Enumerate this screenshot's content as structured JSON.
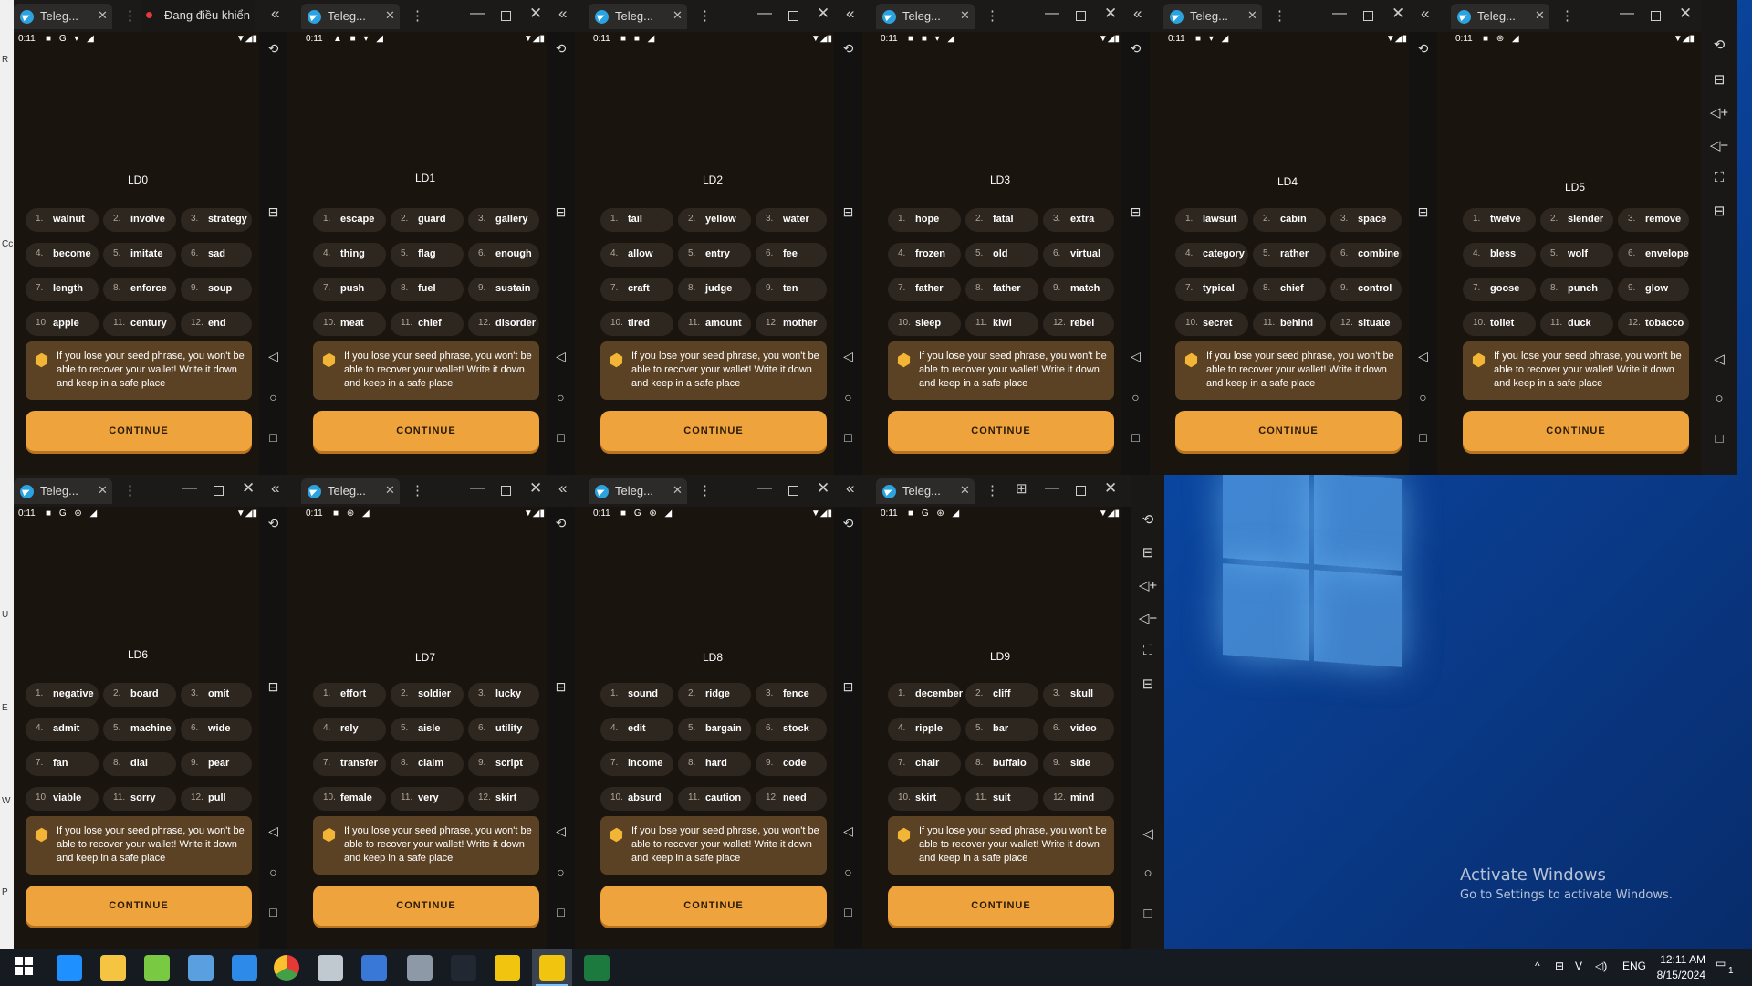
{
  "desktop": {
    "activate_title": "Activate Windows",
    "activate_sub": "Go to Settings to activate Windows."
  },
  "controller_label": "Đang điều khiển",
  "left_strip_letters": [
    "R",
    "Cc",
    "U",
    "E",
    "W",
    "P"
  ],
  "panels": [
    {
      "tab_title": "Teleg...",
      "status_time": "0:11",
      "status_icons": "■ G ▾ ◢",
      "label": "LD0",
      "words": [
        "walnut",
        "involve",
        "strategy",
        "become",
        "imitate",
        "sad",
        "length",
        "enforce",
        "soup",
        "apple",
        "century",
        "end"
      ],
      "warning": "If you lose your seed phrase, you won't be able to recover your wallet! Write it down and keep in a safe place",
      "button": "CONTINUE"
    },
    {
      "tab_title": "Teleg...",
      "status_time": "0:11",
      "status_icons": "▲ ■ ▾ ◢",
      "label": "LD1",
      "words": [
        "escape",
        "guard",
        "gallery",
        "thing",
        "flag",
        "enough",
        "push",
        "fuel",
        "sustain",
        "meat",
        "chief",
        "disorder"
      ],
      "warning": "If you lose your seed phrase, you won't be able to recover your wallet! Write it down and keep in a safe place",
      "button": "CONTINUE"
    },
    {
      "tab_title": "Teleg...",
      "status_time": "0:11",
      "status_icons": "■ ■ ◢",
      "label": "LD2",
      "words": [
        "tail",
        "yellow",
        "water",
        "allow",
        "entry",
        "fee",
        "craft",
        "judge",
        "ten",
        "tired",
        "amount",
        "mother"
      ],
      "warning": "If you lose your seed phrase, you won't be able to recover your wallet! Write it down and keep in a safe place",
      "button": "CONTINUE"
    },
    {
      "tab_title": "Teleg...",
      "status_time": "0:11",
      "status_icons": "■ ■ ▾ ◢",
      "label": "LD3",
      "words": [
        "hope",
        "fatal",
        "extra",
        "frozen",
        "old",
        "virtual",
        "father",
        "father",
        "match",
        "sleep",
        "kiwi",
        "rebel"
      ],
      "warning": "If you lose your seed phrase, you won't be able to recover your wallet! Write it down and keep in a safe place",
      "button": "CONTINUE"
    },
    {
      "tab_title": "Teleg...",
      "status_time": "0:11",
      "status_icons": "■ ▾ ◢",
      "label": "LD4",
      "words": [
        "lawsuit",
        "cabin",
        "space",
        "category",
        "rather",
        "combine",
        "typical",
        "chief",
        "control",
        "secret",
        "behind",
        "situate"
      ],
      "warning": "If you lose your seed phrase, you won't be able to recover your wallet! Write it down and keep in a safe place",
      "button": "CONTINUE"
    },
    {
      "tab_title": "Teleg...",
      "status_time": "0:11",
      "status_icons": "■ ⊛ ◢",
      "label": "LD5",
      "words": [
        "twelve",
        "slender",
        "remove",
        "bless",
        "wolf",
        "envelope",
        "goose",
        "punch",
        "glow",
        "toilet",
        "duck",
        "tobacco"
      ],
      "warning": "If you lose your seed phrase, you won't be able to recover your wallet! Write it down and keep in a safe place",
      "button": "CONTINUE"
    },
    {
      "tab_title": "Teleg...",
      "status_time": "0:11",
      "status_icons": "■ G ⊛ ◢",
      "label": "LD6",
      "words": [
        "negative",
        "board",
        "omit",
        "admit",
        "machine",
        "wide",
        "fan",
        "dial",
        "pear",
        "viable",
        "sorry",
        "pull"
      ],
      "warning": "If you lose your seed phrase, you won't be able to recover your wallet! Write it down and keep in a safe place",
      "button": "CONTINUE"
    },
    {
      "tab_title": "Teleg...",
      "status_time": "0:11",
      "status_icons": "■ ⊛ ◢",
      "label": "LD7",
      "words": [
        "effort",
        "soldier",
        "lucky",
        "rely",
        "aisle",
        "utility",
        "transfer",
        "claim",
        "script",
        "female",
        "very",
        "skirt"
      ],
      "warning": "If you lose your seed phrase, you won't be able to recover your wallet! Write it down and keep in a safe place",
      "button": "CONTINUE"
    },
    {
      "tab_title": "Teleg...",
      "status_time": "0:11",
      "status_icons": "■ G ⊛ ◢",
      "label": "LD8",
      "words": [
        "sound",
        "ridge",
        "fence",
        "edit",
        "bargain",
        "stock",
        "income",
        "hard",
        "code",
        "absurd",
        "caution",
        "need"
      ],
      "warning": "If you lose your seed phrase, you won't be able to recover your wallet! Write it down and keep in a safe place",
      "button": "CONTINUE"
    },
    {
      "tab_title": "Teleg...",
      "status_time": "0:11",
      "status_icons": "■ G ⊛ ◢",
      "label": "LD9",
      "words": [
        "december",
        "cliff",
        "skull",
        "ripple",
        "bar",
        "video",
        "chair",
        "buffalo",
        "side",
        "skirt",
        "suit",
        "mind"
      ],
      "warning": "If you lose your seed phrase, you won't be able to recover your wallet! Write it down and keep in a safe place",
      "button": "CONTINUE"
    }
  ],
  "taskbar": {
    "language": "ENG",
    "time": "12:11 AM",
    "date": "8/15/2024",
    "notification_count": "1",
    "apps": [
      "start-icon",
      "edge-icon",
      "file-explorer-icon",
      "notepad-icon",
      "paint-icon",
      "vscode-icon",
      "chrome-icon",
      "printer-icon",
      "powershell-icon",
      "calculator-icon",
      "terminal-icon",
      "ldplayer-icon",
      "ldmultiplayer-icon",
      "excel-icon"
    ]
  }
}
